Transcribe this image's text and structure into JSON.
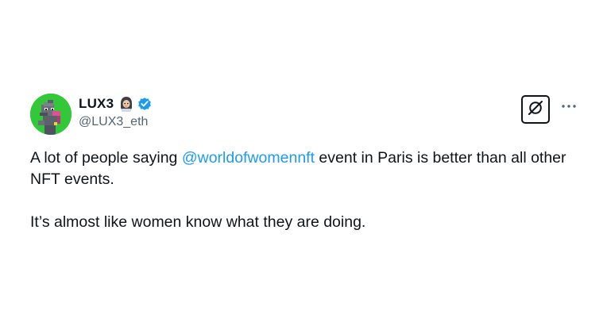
{
  "tweet": {
    "display_name": "LUX3",
    "handle": "@LUX3_eth",
    "name_emoji": "woman-with-headscarf-emoji",
    "verified": true,
    "verified_color": "#1d9bf0",
    "avatar_background": "#32c83a",
    "text_line1_before": "A lot of people saying ",
    "mention": "@worldofwomennft",
    "text_line1_after": " event in Paris is better than all other NFT events.",
    "text_paragraph2": "It’s almost like women know what they are doing.",
    "mention_color": "#1d9bf0"
  },
  "actions": {
    "grok_icon": "grok-icon",
    "more_icon": "more-dots-icon"
  }
}
